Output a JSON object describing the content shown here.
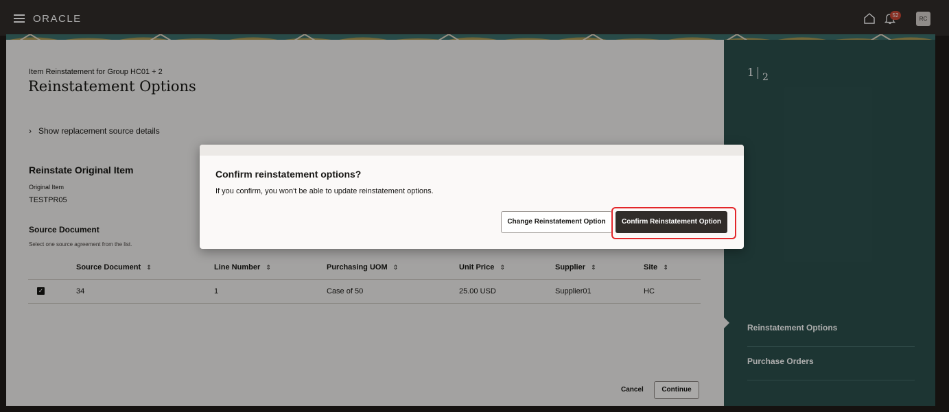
{
  "header": {
    "logo": "ORACLE",
    "notification_count": "52",
    "user_initials": "RC"
  },
  "page": {
    "eyebrow": "Item Reinstatement for Group HC01 + 2",
    "title": "Reinstatement Options",
    "disclosure_label": "Show replacement source details",
    "original_section_title": "Reinstate Original Item",
    "original_item_label": "Original Item",
    "original_item_value": "TESTPR05",
    "source_section_title": "Source Document",
    "source_helper": "Select one source agreement from the list.",
    "cancel_label": "Cancel",
    "continue_label": "Continue"
  },
  "table": {
    "columns": [
      "Source Document",
      "Line Number",
      "Purchasing UOM",
      "Unit Price",
      "Supplier",
      "Site"
    ],
    "rows": [
      {
        "selected": true,
        "source_document": "34",
        "line_number": "1",
        "purchasing_uom": "Case of 50",
        "unit_price": "25.00 USD",
        "supplier": "Supplier01",
        "site": "HC"
      }
    ]
  },
  "train": {
    "current_step": "1",
    "total_steps": "2",
    "steps": [
      "Reinstatement Options",
      "Purchase Orders"
    ]
  },
  "dialog": {
    "title": "Confirm reinstatement options?",
    "message": "If you confirm, you won't be able to update reinstatement options.",
    "secondary_button": "Change Reinstatement Option",
    "primary_button": "Confirm Reinstatement Option"
  },
  "colors": {
    "header_bg": "#312d2a",
    "side_panel_bg": "#2c4f4c",
    "primary_button_bg": "#312d2a",
    "highlight": "#e3262a",
    "badge": "#c74634"
  }
}
